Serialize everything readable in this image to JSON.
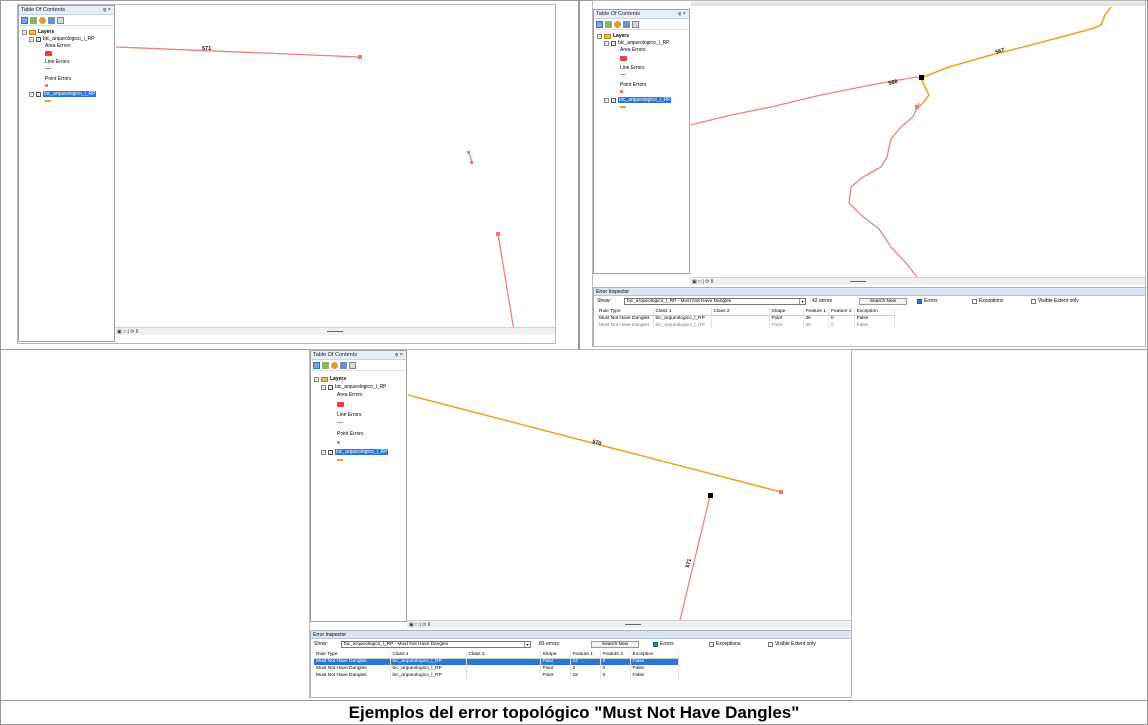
{
  "toc": {
    "title": "Table Of Contents",
    "pin": "ȩ ×",
    "layers": "Layers",
    "layer_name": "bic_arqueologico_l_RP",
    "area_errors": "Area Errors",
    "line_errors": "Line Errors",
    "point_errors": "Point Errors"
  },
  "map1": {
    "line_label": "571"
  },
  "map2": {
    "label_a": "567",
    "label_b": "568"
  },
  "map3": {
    "label_a": "570",
    "label_b": "571"
  },
  "status_bar": {
    "controls": "▣ □ | ⟳ II"
  },
  "error_inspector_top": {
    "title": "Error Inspector",
    "show_label": "Show:",
    "filter_value": "bic_arqueologico_l_RP - Must Not Have Dangles",
    "error_count": "42 errors",
    "search_button": "Search Now",
    "errors_checkbox": "Errors",
    "exceptions_checkbox": "Exceptions",
    "visible_extent_checkbox": "Visible Extent only",
    "columns": [
      "Rule Type",
      "Class 1",
      "Class 2",
      "Shape",
      "Feature 1",
      "Feature 2",
      "Exception"
    ],
    "rows": [
      [
        "Must Not Have Dangles",
        "bic_arqueologico_l_RP",
        "",
        "Point",
        "36",
        "0",
        "False"
      ],
      [
        "Must Not Have Dangles",
        "bic_arqueologico_l_RP",
        "",
        "Point",
        "40",
        "0",
        "False"
      ]
    ]
  },
  "error_inspector_bottom": {
    "title": "Error Inspector",
    "show_label": "Show:",
    "filter_value": "bic_arqueologico_l_RP - Must Not Have Dangles",
    "error_count": "83 errors",
    "search_button": "Search Now",
    "errors_checkbox": "Errors",
    "exceptions_checkbox": "Exceptions",
    "visible_extent_checkbox": "Visible Extent only",
    "columns": [
      "Rule Type",
      "Class 1",
      "Class 2",
      "Shape",
      "Feature 1",
      "Feature 2",
      "Exception"
    ],
    "rows": [
      [
        "Must Not Have Dangles",
        "bic_arqueologico_l_RP",
        "",
        "Point",
        "24",
        "0",
        "False"
      ],
      [
        "Must Not Have Dangles",
        "bic_arqueologico_l_RP",
        "",
        "Point",
        "3",
        "0",
        "False"
      ],
      [
        "Must Not Have Dangles",
        "bic_arqueologico_l_RP",
        "",
        "Point",
        "19",
        "0",
        "False"
      ]
    ],
    "selected_row": 0
  },
  "caption": "Ejemplos del error topológico \"Must Not Have Dangles\"",
  "colors": {
    "error_line": "#f08080",
    "orange_line": "#f0a020",
    "selection_blue": "#2a77d6"
  }
}
